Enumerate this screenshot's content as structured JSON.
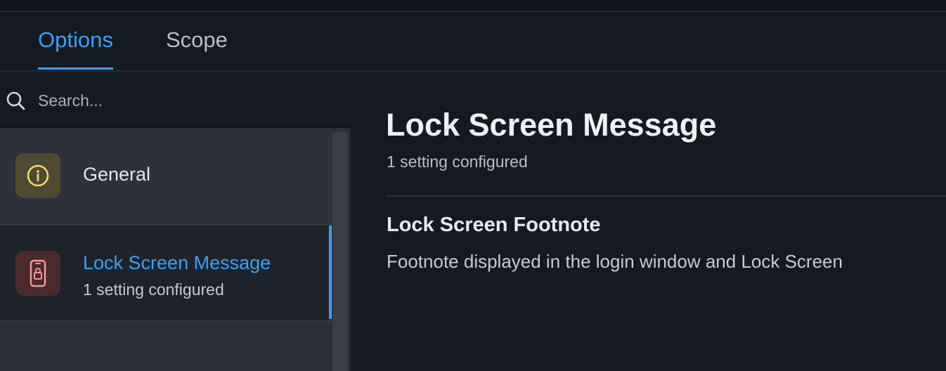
{
  "tabs": [
    {
      "label": "Options",
      "active": true
    },
    {
      "label": "Scope",
      "active": false
    }
  ],
  "search": {
    "placeholder": "Search..."
  },
  "sidebar": {
    "items": [
      {
        "title": "General",
        "icon": "info-icon"
      },
      {
        "title": "Lock Screen Message",
        "subtitle": "1 setting configured",
        "icon": "phone-lock-icon",
        "selected": true
      }
    ]
  },
  "main": {
    "title": "Lock Screen Message",
    "subtitle": "1 setting configured",
    "setting": {
      "title": "Lock Screen Footnote",
      "description": "Footnote displayed in the login window and Lock Screen"
    }
  },
  "colors": {
    "accent": "#3f9ff2",
    "background": "#151a22",
    "sidebar": "#2a2f38"
  }
}
